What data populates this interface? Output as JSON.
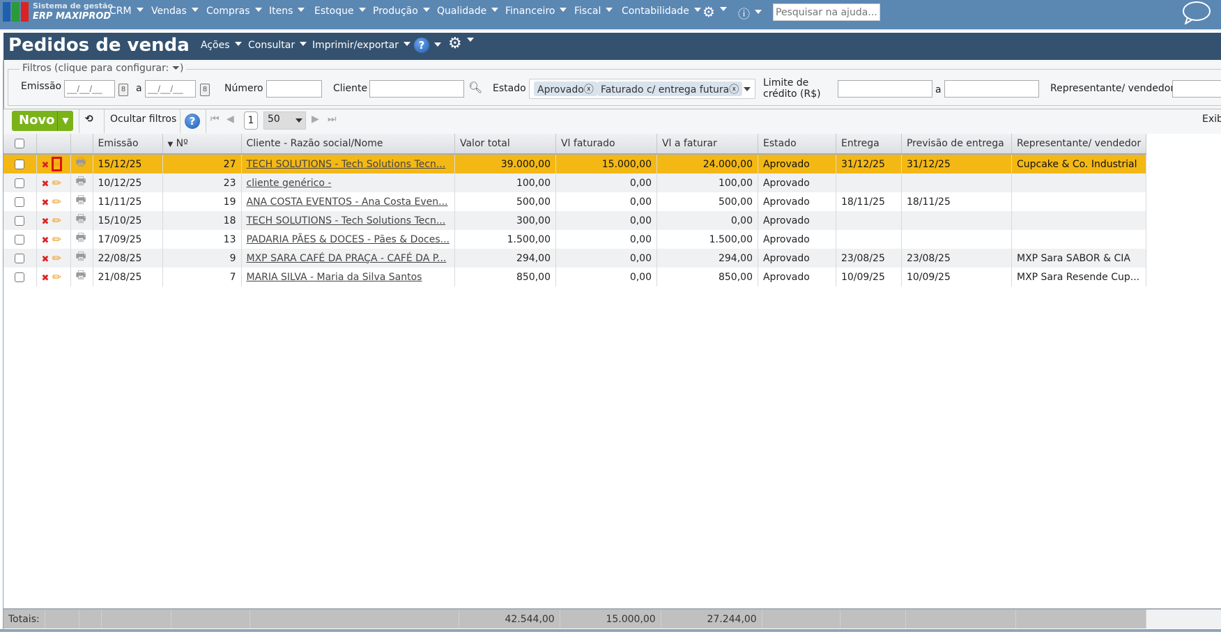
{
  "topnav": {
    "brand_small": "Sistema de gestão",
    "brand": "ERP MAXIPROD",
    "menus": [
      "CRM",
      "Vendas",
      "Compras",
      "Itens",
      "Estoque",
      "Produção",
      "Qualidade",
      "Financeiro",
      "Fiscal",
      "Contabilidade"
    ],
    "search_placeholder": "Pesquisar na ajuda..."
  },
  "titlebar": {
    "title": "Pedidos de venda",
    "menus": [
      "Ações",
      "Consultar",
      "Imprimir/exportar"
    ],
    "help": "?"
  },
  "filters": {
    "legend": "Filtros (clique para configurar:",
    "legend_end": ")",
    "emissao": "Emissão",
    "date_placeholder": "__/__/__",
    "a": "a",
    "numero": "Número",
    "cliente": "Cliente",
    "estado": "Estado",
    "estado_tags": [
      "Aprovado",
      "Faturado c/ entrega futura"
    ],
    "limite_1": "Limite de",
    "limite_2": "crédito (R$)",
    "representante": "Representante/ vendedor"
  },
  "toolbar": {
    "novo": "Novo",
    "ocultar": "Ocultar filtros",
    "page": "1",
    "page_size": "50",
    "exib": "Exib"
  },
  "table": {
    "headers": [
      "Emissão",
      "Nº",
      "Cliente - Razão social/Nome",
      "Valor total",
      "Vl faturado",
      "Vl a faturar",
      "Estado",
      "Entrega",
      "Previsão de entrega",
      "Representante/ vendedor"
    ],
    "rows": [
      [
        "15/12/25",
        "27",
        "TECH SOLUTIONS - Tech Solutions Tecn...",
        "39.000,00",
        "15.000,00",
        "24.000,00",
        "Aprovado",
        "31/12/25",
        "31/12/25",
        "Cupcake & Co. Industrial"
      ],
      [
        "10/12/25",
        "23",
        "cliente genérico -",
        "100,00",
        "0,00",
        "100,00",
        "Aprovado",
        "",
        "",
        ""
      ],
      [
        "11/11/25",
        "19",
        "ANA COSTA EVENTOS - Ana Costa Even...",
        "500,00",
        "0,00",
        "500,00",
        "Aprovado",
        "18/11/25",
        "18/11/25",
        ""
      ],
      [
        "15/10/25",
        "18",
        "TECH SOLUTIONS - Tech Solutions Tecn...",
        "300,00",
        "0,00",
        "0,00",
        "Aprovado",
        "",
        "",
        ""
      ],
      [
        "17/09/25",
        "13",
        "PADARIA PÃES & DOCES - Pães & Doces...",
        "1.500,00",
        "0,00",
        "1.500,00",
        "Aprovado",
        "",
        "",
        ""
      ],
      [
        "22/08/25",
        "9",
        "MXP SARA CAFÉ DA PRAÇA - CAFÉ DA P...",
        "294,00",
        "0,00",
        "294,00",
        "Aprovado",
        "23/08/25",
        "23/08/25",
        "MXP Sara SABOR & CIA"
      ],
      [
        "21/08/25",
        "7",
        "MARIA SILVA - Maria da Silva Santos",
        "850,00",
        "0,00",
        "850,00",
        "Aprovado",
        "10/09/25",
        "10/09/25",
        "MXP Sara Resende Cup..."
      ]
    ]
  },
  "totals": {
    "label": "Totais:",
    "valor_total": "42.544,00",
    "vl_faturado": "15.000,00",
    "vl_a_faturar": "27.244,00"
  },
  "colors": {
    "nav": "#5b87b3",
    "titlebar": "#34526f",
    "selected_row": "#f4b815",
    "novo": "#7ab317"
  }
}
